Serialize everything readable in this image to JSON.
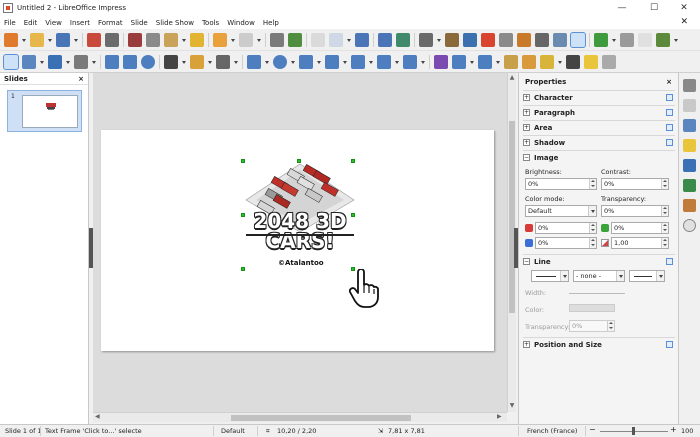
{
  "window": {
    "title": "Untitled 2 - LibreOffice Impress",
    "controls": {
      "minimize": "—",
      "maximize": "☐",
      "close": "✕"
    }
  },
  "menu": {
    "items": [
      "File",
      "Edit",
      "View",
      "Insert",
      "Format",
      "Slide",
      "Slide Show",
      "Tools",
      "Window",
      "Help"
    ],
    "close_doc": "✕"
  },
  "slides_panel": {
    "title": "Slides",
    "close": "×",
    "slide_number": "1"
  },
  "slide_content": {
    "logo_line1": "2048 3D",
    "logo_line2": "CARS!",
    "copyright": "©Atalantoo"
  },
  "properties": {
    "title": "Properties",
    "close": "×",
    "sections": {
      "character": "Character",
      "paragraph": "Paragraph",
      "area": "Area",
      "shadow": "Shadow",
      "image": "Image",
      "line": "Line",
      "position_size": "Position and Size"
    },
    "collapsed_mark": "+",
    "expanded_mark": "−",
    "image": {
      "brightness_label": "Brightness:",
      "brightness_value": "0%",
      "contrast_label": "Contrast:",
      "contrast_value": "0%",
      "color_mode_label": "Color mode:",
      "color_mode_value": "Default",
      "transparency_label": "Transparency:",
      "transparency_value": "0%",
      "red_value": "0%",
      "green_value": "0%",
      "blue_value": "0%",
      "gamma_value": "1,00"
    },
    "line": {
      "style_value": "- none -",
      "width_label": "Width:",
      "color_label": "Color:",
      "transparency_label": "Transparency:",
      "transparency_value": "0%"
    }
  },
  "status": {
    "slide": "Slide 1 of 1",
    "selection": "Text Frame 'Click to...' selecte",
    "layout": "Default",
    "position": "10,20 / 2,20",
    "size": "7,81 x 7,81",
    "language": "French (France)",
    "zoom_minus": "−",
    "zoom_plus": "+",
    "zoom": "100"
  },
  "colors": {
    "accent": "#5b8fd6",
    "handle": "#26c226",
    "slide_bg": "#ffffff",
    "workspace_bg": "#dcdcdc"
  }
}
